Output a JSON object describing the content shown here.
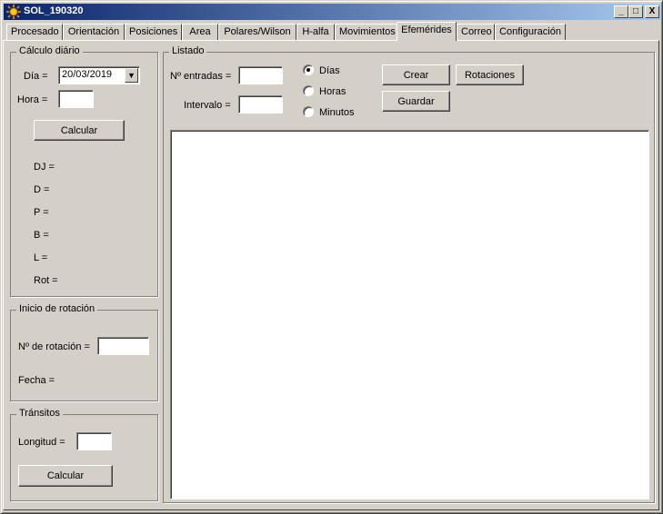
{
  "window": {
    "title": "SOL_190320",
    "minimize_label": "_",
    "maximize_label": "□",
    "close_label": "X"
  },
  "tabs": [
    {
      "label": "Procesado"
    },
    {
      "label": "Orientación"
    },
    {
      "label": "Posiciones"
    },
    {
      "label": "Area"
    },
    {
      "label": "Polares/Wilson"
    },
    {
      "label": "H-alfa"
    },
    {
      "label": "Movimientos"
    },
    {
      "label": "Efemérides",
      "active": true
    },
    {
      "label": "Correo"
    },
    {
      "label": "Configuración"
    }
  ],
  "calculo_diario": {
    "title": "Cálculo diário",
    "dia_label": "Día =",
    "dia_value": "20/03/2019",
    "hora_label": "Hora =",
    "hora_value": "",
    "calcular_label": "Calcular",
    "dj_label": "DJ =",
    "d_label": "D =",
    "p_label": "P =",
    "b_label": "B =",
    "l_label": "L =",
    "rot_label": "Rot ="
  },
  "inicio_rotacion": {
    "title": "Inicio de rotación",
    "num_rotacion_label": "Nº de rotación =",
    "num_rotacion_value": "",
    "fecha_label": "Fecha ="
  },
  "transitos": {
    "title": "Tránsitos",
    "longitud_label": "Longitud =",
    "longitud_value": "",
    "calcular_label": "Calcular"
  },
  "listado": {
    "title": "Listado",
    "entradas_label": "Nº entradas =",
    "entradas_value": "",
    "intervalo_label": "Intervalo =",
    "intervalo_value": "",
    "radio_dias": "Días",
    "radio_horas": "Horas",
    "radio_minutos": "Minutos",
    "selected_unit": "Días",
    "crear_label": "Crear",
    "rotaciones_label": "Rotaciones",
    "guardar_label": "Guardar"
  }
}
